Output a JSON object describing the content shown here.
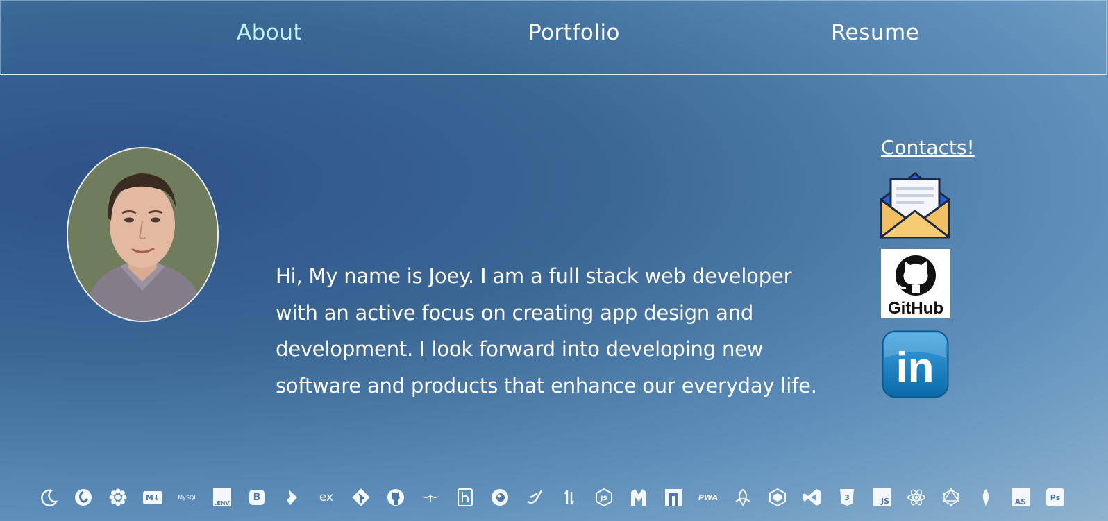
{
  "nav": {
    "about": "About",
    "portfolio": "Portfolio",
    "resume": "Resume"
  },
  "profile": {
    "bio": "Hi, My name is Joey. I am a full stack web developer with an active focus on creating app design and development. I look forward into developing new software and products that enhance our everyday life."
  },
  "contacts": {
    "heading": "Contacts!",
    "items": [
      {
        "name": "email",
        "icon": "envelope-icon"
      },
      {
        "name": "github",
        "icon": "github-icon",
        "label": "GitHub"
      },
      {
        "name": "linkedin",
        "icon": "linkedin-icon",
        "label": "in"
      }
    ]
  },
  "tech_stack": {
    "icons": [
      "moon-icon",
      "swirl-icon",
      "flower-icon",
      "markdown-icon",
      "mysql-icon",
      "env-icon",
      "bootstrap-icon",
      "feather-icon",
      "express-icon",
      "git-icon",
      "github-icon",
      "handlebars-icon",
      "heroku-icon",
      "circle-eye-icon",
      "slash-icon",
      "arrows-icon",
      "nodejs-icon",
      "mongoose-icon",
      "npm-icon",
      "pwa-icon",
      "knot-icon",
      "cube-icon",
      "vscode-icon",
      "css3-icon",
      "javascript-icon",
      "react-icon",
      "graphql-icon",
      "mongodb-icon",
      "assemblyscript-icon",
      "photoshop-icon"
    ],
    "labels": {
      "markdown": "M↓",
      "mysql": "MySQL",
      "env": ".ENV",
      "bootstrap": "B",
      "express": "ex",
      "pwa": "PWA",
      "javascript": "JS",
      "assemblyscript": "AS",
      "photoshop": "Ps"
    }
  },
  "colors": {
    "active_nav": "#bdf4ff",
    "text": "#ffffff",
    "gradient_dark": "#2e5287",
    "gradient_light": "#8fb3cf"
  }
}
